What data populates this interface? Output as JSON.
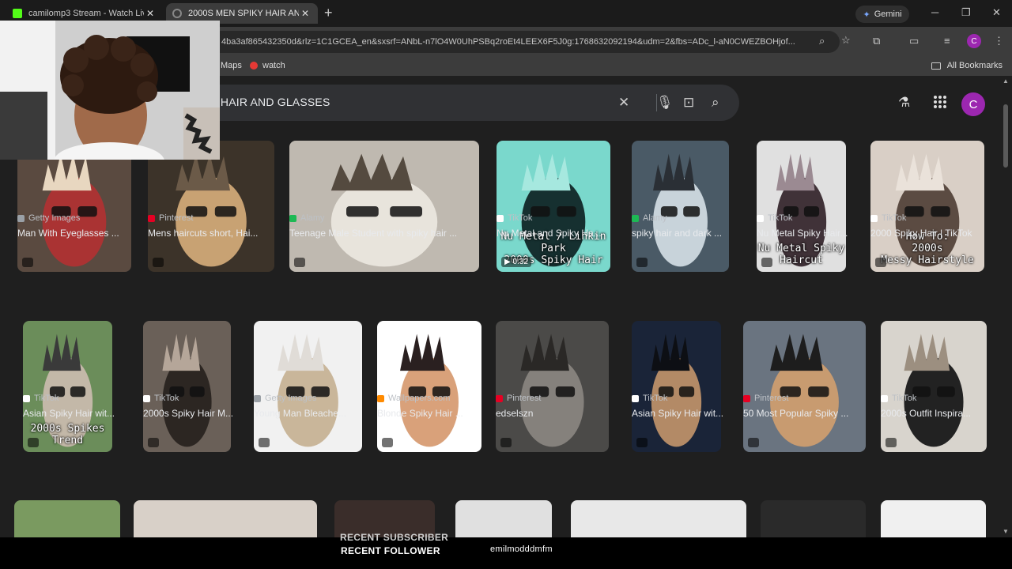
{
  "tabs": [
    {
      "title": "camilomp3 Stream - Watch Live",
      "fav": "#53fc18"
    },
    {
      "title": "2000S MEN SPIKY HAIR AND GLASSES",
      "fav": "#888888"
    }
  ],
  "window": {
    "gemini": "Gemini",
    "minimize": "─",
    "maximize": "❐",
    "close": "✕"
  },
  "omnibox": {
    "url": "4ba3af865432350d&rlz=1C1GCEA_en&sxsrf=ANbL-n7lO4W0UhPSBq2roEt4LEEX6F5J0g:1768632092194&udm=2&fbs=ADc_l-aN0CWEZBOHjof..."
  },
  "bookmarks": {
    "items": [
      {
        "label": "Maps"
      },
      {
        "label": "watch"
      }
    ],
    "all": "All Bookmarks"
  },
  "profile": {
    "initial": "C"
  },
  "search": {
    "query": "KY HAIR AND GLASSES"
  },
  "rows": [
    [
      {
        "source": "Getty Images",
        "title": "Man With Eyeglasses ...",
        "icon": "#9aa0a6",
        "colors": [
          "#5a4a40",
          "#a33",
          "#e8d7c0"
        ]
      },
      {
        "source": "Pinterest",
        "title": "Mens haircuts short, Hai...",
        "icon": "#e60023",
        "colors": [
          "#3c3329",
          "#c8a273",
          "#6b5a48"
        ]
      },
      {
        "source": "Alamy",
        "title": "Teenage Male Student with spiky hair ...",
        "icon": "#1db954",
        "colors": [
          "#bfb9b0",
          "#e8e4dc",
          "#544a3f"
        ]
      },
      {
        "source": "TikTok",
        "title": "Nu Metal and Spiky Ha...",
        "icon": "#fff",
        "colors": [
          "#7ad8cc",
          "#163030",
          "#a6e8df"
        ],
        "duration": "0:32",
        "overlay": "Nu Metal / Linkin Park\n2000s Spiky Hair"
      },
      {
        "source": "Alamy",
        "title": "spiky hair and dark ...",
        "icon": "#1db954",
        "colors": [
          "#4a5a66",
          "#c8d3da",
          "#2a2f35"
        ]
      },
      {
        "source": "TikTok",
        "title": "Nu Metal Spiky Hair...",
        "icon": "#fff",
        "colors": [
          "#e0e0e0",
          "#403238",
          "#9b8a92"
        ],
        "overlay": "Nu Metal Spiky Haircut"
      },
      {
        "source": "TikTok",
        "title": "2000 Spiky Hair | TikTok",
        "icon": "#fff",
        "colors": [
          "#d9cfc6",
          "#5b4b42",
          "#eae2da"
        ],
        "overlay": "How To:\n2000s\nMessy Hairstyle"
      }
    ],
    [
      {
        "source": "TikTok",
        "title": "Asian Spiky Hair wit...",
        "icon": "#fff",
        "colors": [
          "#6b8d5a",
          "#c3b8a8",
          "#3a3a3a"
        ],
        "overlay": "2000s Spikes Trend"
      },
      {
        "source": "TikTok",
        "title": "2000s Spiky Hair M...",
        "icon": "#fff",
        "colors": [
          "#6a6058",
          "#2c2622",
          "#b5a699"
        ]
      },
      {
        "source": "Getty Images",
        "title": "Young Man Bleache...",
        "icon": "#9aa0a6",
        "colors": [
          "#f1f1f1",
          "#c9b69a",
          "#e0dcd7"
        ]
      },
      {
        "source": "Wallpapers.com",
        "title": "Blonde Spiky Hair ...",
        "icon": "#ff8a00",
        "colors": [
          "#ffffff",
          "#d9a17a",
          "#2a2020"
        ]
      },
      {
        "source": "Pinterest",
        "title": "edselszn",
        "icon": "#e60023",
        "colors": [
          "#4b4a48",
          "#85817c",
          "#2a2826"
        ]
      },
      {
        "source": "TikTok",
        "title": "Asian Spiky Hair wit...",
        "icon": "#fff",
        "colors": [
          "#1a2438",
          "#b38a66",
          "#0d0f14"
        ]
      },
      {
        "source": "Pinterest",
        "title": "50 Most Popular Spiky ...",
        "icon": "#e60023",
        "colors": [
          "#6a7480",
          "#c89b70",
          "#1d1d1d"
        ]
      },
      {
        "source": "TikTok",
        "title": "2000s Outfit Inspira...",
        "icon": "#fff",
        "colors": [
          "#d8d4cd",
          "#222",
          "#9c8f80"
        ]
      }
    ]
  ],
  "stream_overlay": {
    "line1": "RECENT SUBSCRIBER",
    "line2": "RECENT FOLLOWER",
    "name": "emilmodddmfm"
  }
}
